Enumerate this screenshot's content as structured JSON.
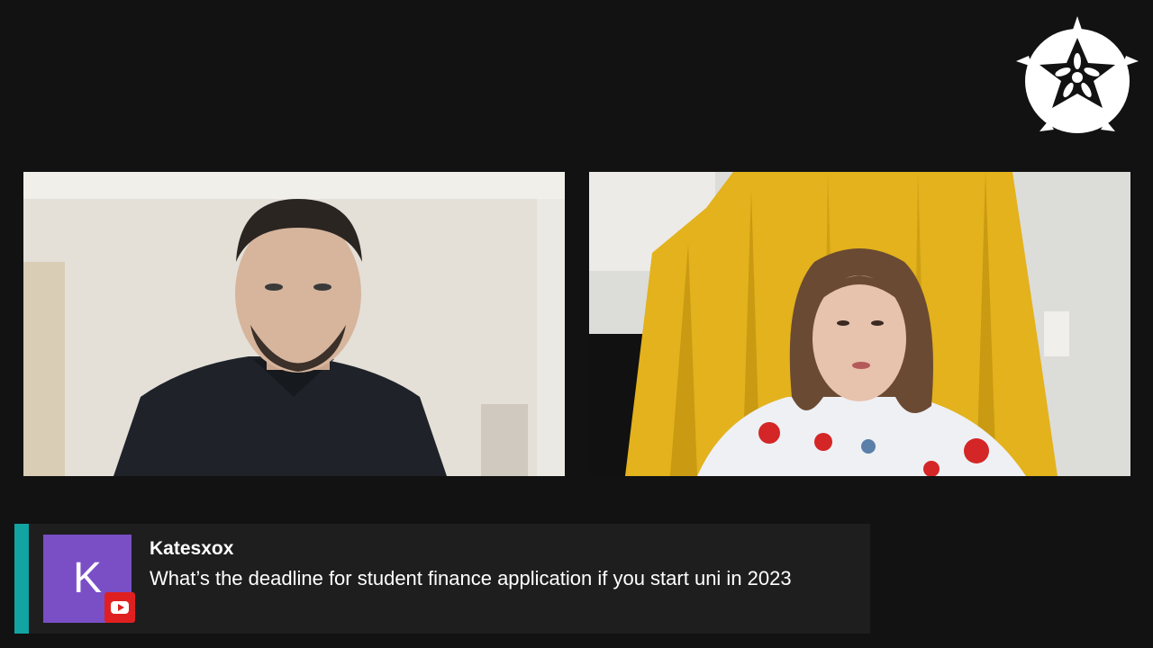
{
  "logo": {
    "icon": "rose-emblem-icon",
    "color": "#ffffff"
  },
  "participants": [
    {
      "role": "host",
      "shirt": "dark plaid"
    },
    {
      "role": "guest",
      "curtain_color": "#e3b21c"
    }
  ],
  "comment": {
    "author": "Katesxox",
    "avatar_letter": "K",
    "avatar_color": "#7a4fc6",
    "accent_color": "#12a3a3",
    "platform_icon": "youtube-icon",
    "message": "What’s the deadline for student finance application if you start uni in 2023"
  }
}
